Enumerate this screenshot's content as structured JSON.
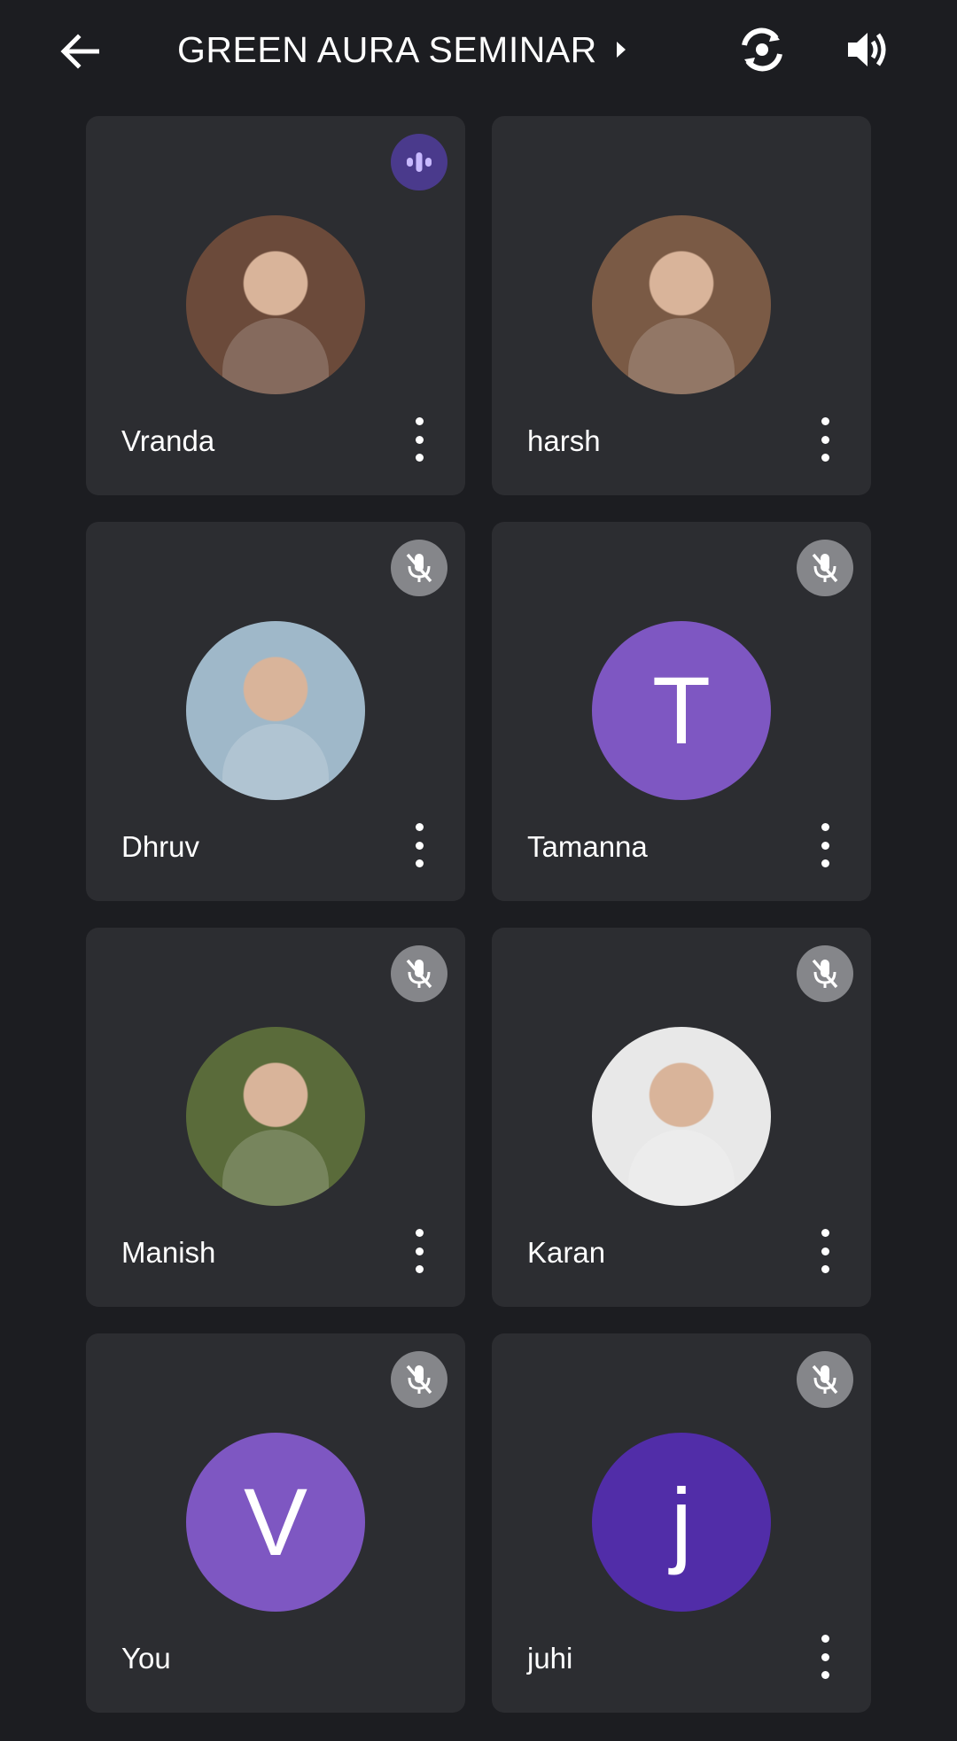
{
  "header": {
    "title": "GREEN AURA SEMINAR",
    "back_icon": "arrow-left-icon",
    "caret_icon": "caret-right-icon",
    "switch_camera_icon": "switch-camera-icon",
    "speaker_icon": "speaker-icon"
  },
  "participants": [
    {
      "name": "Vranda",
      "status": "speaking",
      "avatar": "photo",
      "photo_bg": "#6b4a3a"
    },
    {
      "name": "harsh",
      "status": "none",
      "avatar": "photo",
      "photo_bg": "#7a5a45"
    },
    {
      "name": "Dhruv",
      "status": "muted",
      "avatar": "photo",
      "photo_bg": "#9fb8c9"
    },
    {
      "name": "Tamanna",
      "status": "muted",
      "avatar": "initial",
      "initial": "T",
      "color": "#7e57c2"
    },
    {
      "name": "Manish",
      "status": "muted",
      "avatar": "photo",
      "photo_bg": "#5a6b3a"
    },
    {
      "name": "Karan",
      "status": "muted",
      "avatar": "photo",
      "photo_bg": "#e8e8e8"
    },
    {
      "name": "You",
      "status": "muted",
      "avatar": "initial",
      "initial": "V",
      "color": "#7e57c2"
    },
    {
      "name": "juhi",
      "status": "muted",
      "avatar": "initial",
      "initial": "j",
      "color": "#512da8"
    }
  ],
  "colors": {
    "background": "#1c1d21",
    "tile": "#2c2d31",
    "muted_badge": "#85868a",
    "speaking_badge": "#4a3a8c"
  }
}
